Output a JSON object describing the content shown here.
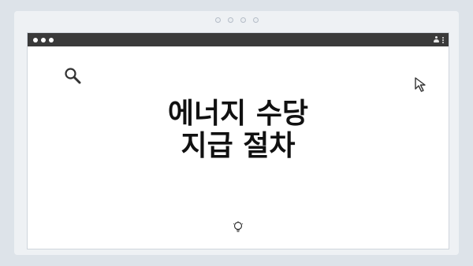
{
  "page": {
    "title_line1": "에너지 수당",
    "title_line2": "지급 절차"
  },
  "icons": {
    "search": "search-icon",
    "cursor": "cursor-arrow-icon",
    "bulb": "lightbulb-icon",
    "user": "user-icon",
    "menu": "kebab-menu-icon"
  },
  "colors": {
    "titlebar": "#3a3a3a",
    "background": "#dde3e9",
    "window": "#ffffff",
    "text": "#111111"
  }
}
